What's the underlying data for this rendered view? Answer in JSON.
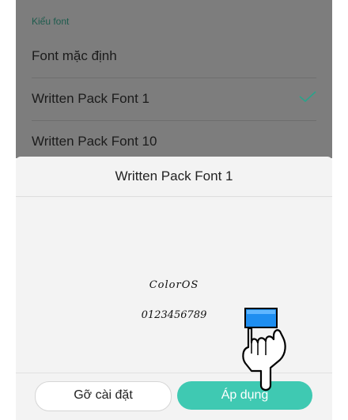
{
  "background_list": {
    "section_header": "Kiểu font",
    "items": [
      {
        "label": "Font mặc định",
        "selected": false
      },
      {
        "label": "Written Pack Font 1",
        "selected": true
      },
      {
        "label": "Written Pack Font 10",
        "selected": false
      }
    ]
  },
  "sheet": {
    "title": "Written Pack Font 1",
    "preview_name": "ColorOS",
    "preview_digits": "0123456789",
    "uninstall_label": "Gỡ cài đặt",
    "apply_label": "Áp dụng"
  },
  "colors": {
    "accent": "#3fc9b2",
    "check": "#2aa38b",
    "dim_background": "#7d7d7d"
  },
  "icons": {
    "selected_mark": "checkmark-icon",
    "pointer": "hand-pointer-icon"
  }
}
